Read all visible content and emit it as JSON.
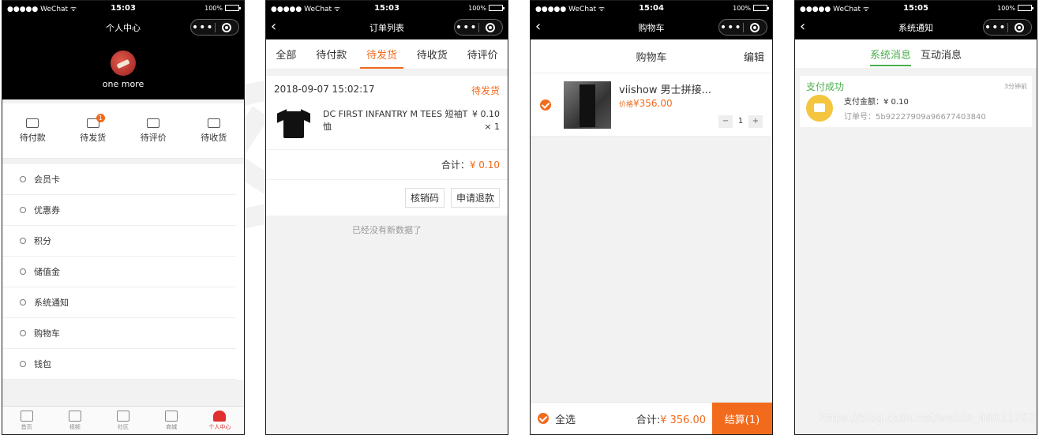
{
  "statusbar": {
    "carrier": "●●●●● WeChat ᯤ",
    "battery": "100%"
  },
  "screens": {
    "profile": {
      "time": "15:03",
      "title": "个人中心",
      "nickname": "one more",
      "orders": [
        {
          "label": "待付款"
        },
        {
          "label": "待发货",
          "badge": "1"
        },
        {
          "label": "待评价"
        },
        {
          "label": "待收货"
        }
      ],
      "menu": [
        "会员卡",
        "优惠券",
        "积分",
        "储值金",
        "系统通知",
        "购物车",
        "钱包"
      ],
      "tabbar": [
        "首页",
        "视频",
        "社区",
        "商城",
        "个人中心"
      ]
    },
    "orders": {
      "time": "15:03",
      "title": "订单列表",
      "tabs": [
        "全部",
        "待付款",
        "待发货",
        "待收货",
        "待评价"
      ],
      "order": {
        "date": "2018-09-07 15:02:17",
        "status": "待发货",
        "name": "DC FIRST INFANTRY M TEES 短袖T恤",
        "price": "¥ 0.10",
        "qty": "× 1",
        "total_label": "合计：",
        "total": "¥ 0.10",
        "btn_verify": "核销码",
        "btn_refund": "申请退款"
      },
      "no_more": "已经没有新数据了"
    },
    "cart": {
      "time": "15:04",
      "title": "购物车",
      "heading": "购物车",
      "edit": "编辑",
      "item": {
        "name": "viishow 男士拼接...",
        "price_label": "价格",
        "price": "¥356.00",
        "minus": "−",
        "qty": "1",
        "plus": "+"
      },
      "select_all": "全选",
      "total_label": "合计:",
      "total": "¥ 356.00",
      "checkout": "结算(1)"
    },
    "notice": {
      "time": "15:05",
      "title": "系统通知",
      "tabs": [
        "系统消息",
        "互动消息"
      ],
      "card": {
        "title": "支付成功",
        "time": "3分钟前",
        "amount": "支付金额：¥ 0.10",
        "order_no": "订单号：5b92227909a96677403840"
      }
    }
  },
  "watermark": "https://blog.csdn.net/weixin_44011762"
}
